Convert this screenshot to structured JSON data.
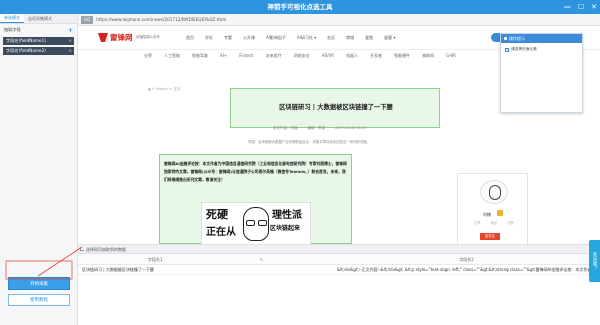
{
  "app": {
    "title": "神箭手可视化点选工具",
    "min": "—",
    "restore": "☐",
    "close": "✕"
  },
  "left": {
    "tabs": [
      "单选模式",
      "连续采集模式"
    ],
    "section_label": "抽取字段",
    "add": "+",
    "fields": [
      "字段名(fieldName1)",
      "字段名(fieldName2)"
    ],
    "start_button": "开始采集",
    "use_button": "使用教程"
  },
  "urlbar": {
    "go": "GO",
    "url": "https://www.leiphone.com/news/201712/WlfDlEEQEXkUZ.html"
  },
  "site": {
    "logo": "雷锋网",
    "slogan": "读懂智能&未来",
    "topnav": [
      "首页",
      "学社",
      "专题",
      "公开课",
      "AI影响因子",
      "AI研习社",
      "AI研习社 ▾",
      "社区",
      "商城",
      "爱推",
      "极客 ▾"
    ],
    "ai_button": "● 神箭手社群平台",
    "subnav": [
      "业界",
      "人工智能",
      "智能驾驶",
      "AI+",
      "Fintech",
      "未来医疗",
      "网络安全",
      "AR/VR",
      "机器人",
      "开发者",
      "智能硬件",
      "物联网",
      "GAIR"
    ],
    "breadcrumb": "▲ > Fintech > 正文",
    "headline": "区块链研习 | 大数据被区块链撞了一下腰",
    "meta": [
      "本文作者：刘楠",
      "编辑：思南",
      "2017-12-08 15:27"
    ],
    "summary": "导语：区块链和大数据产业有哪些结合点，本篇文章将给你回答这一系列的问题。",
    "article": "雷锋网AI金融评论按：本文作者为中国信息通信研究院（工业和信息化部电信研究院）专家刘丽博士，雷锋网独家特约文章，雷锋网(公众号：雷锋网)与信通院子公司泰尔英福（微信号Teleinfo_）联合首发，未来，我们将继续推出系列文章，敬请关注！",
    "poster": [
      "死硬",
      "正在从",
      "理性派",
      "区块链起来"
    ],
    "author": "刘楠",
    "stats": [
      "文章",
      "粉丝",
      "点赞"
    ],
    "follow": "加关注"
  },
  "popup": {
    "title": "操作提示",
    "option": "请选择页面元素"
  },
  "grid": {
    "title": "选择网页抽取到的数据",
    "columns": [
      "字段名1",
      "字段名2"
    ],
    "rows": [
      [
        "区块链研习 | 大数据被区块链撞了一下腰",
        "&lt;div&gt;--正文内容--&lt;/div&gt; &lt;p style=\"text-align: left;\" class=\"\"&gt;&lt;strong class=\"\"&gt;雷锋网AI金融评论按：本文作者为中国信息通信研究院"
      ]
    ]
  },
  "float_button": "有问题？",
  "colors": {
    "accent": "#2f94e0",
    "brand": "#d6241c",
    "highlight": "#e8f7e8"
  }
}
